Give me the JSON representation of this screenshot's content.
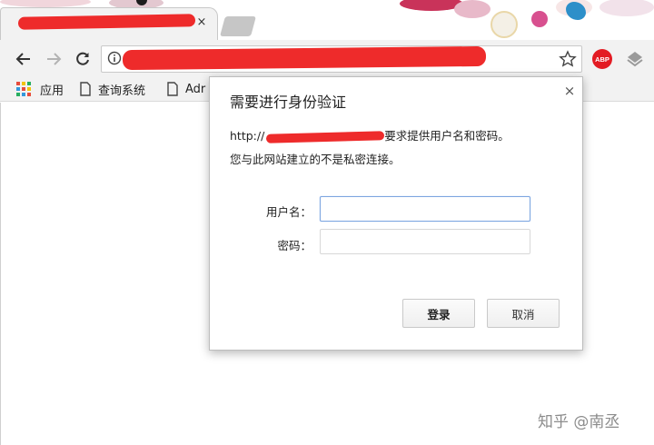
{
  "browser": {
    "tab": {
      "close_glyph": "×"
    },
    "bookmarks": [
      {
        "label": "应用",
        "icon": "apps-grid-icon"
      },
      {
        "label": "查询系统",
        "icon": "page-icon"
      },
      {
        "label": "Adr",
        "icon": "page-icon"
      }
    ],
    "extensions": {
      "abp_label": "ABP"
    }
  },
  "dialog": {
    "title": "需要进行身份验证",
    "message_prefix": "http://",
    "message_suffix": "要求提供用户名和密码。",
    "privacy_note": "您与此网站建立的不是私密连接。",
    "username_label": "用户名：",
    "password_label": "密码：",
    "username_value": "",
    "password_value": "",
    "login_button": "登录",
    "cancel_button": "取消",
    "close_glyph": "×"
  },
  "watermark": "知乎 @南丞",
  "colors": {
    "redaction": "#ee2b2b",
    "abp": "#e31b23",
    "focus": "#7ea6e0"
  }
}
